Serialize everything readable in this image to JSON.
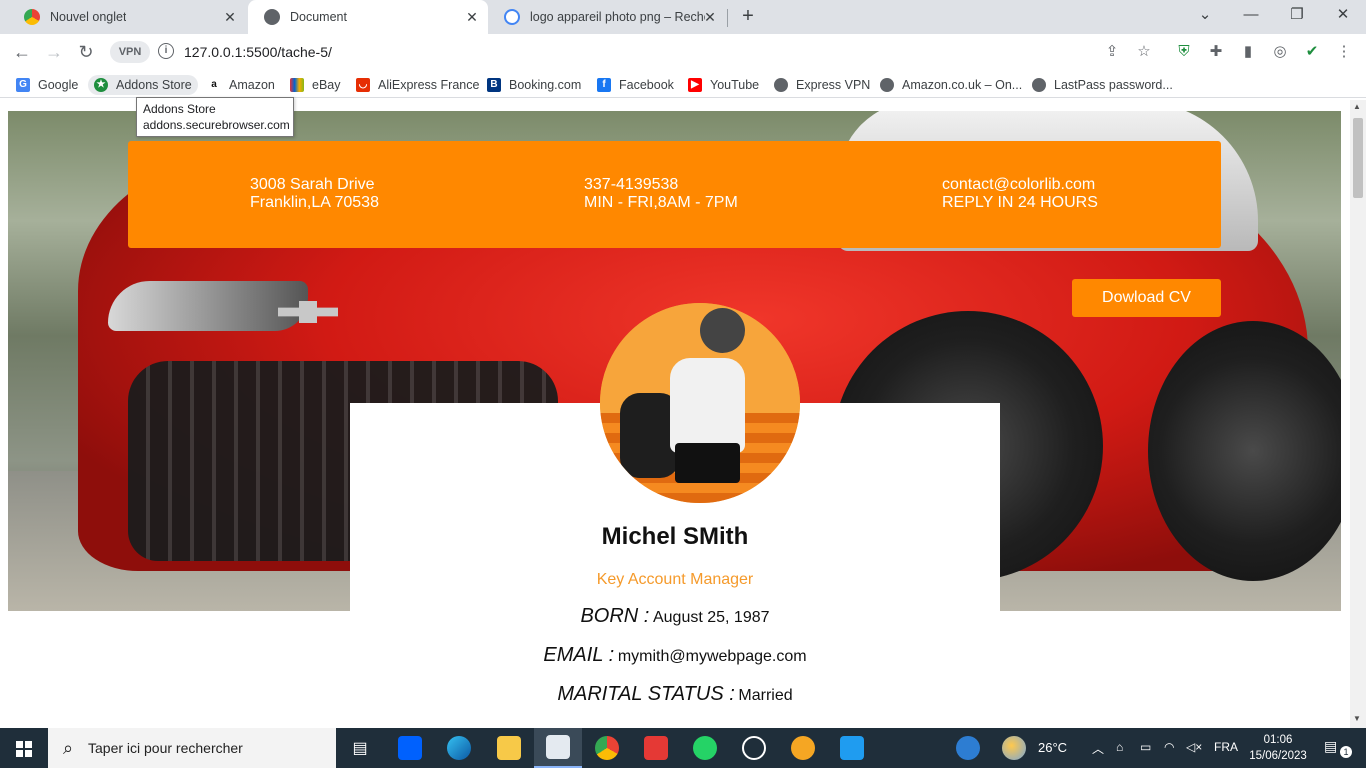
{
  "browser": {
    "tabs": [
      {
        "label": "Nouvel onglet",
        "active": false
      },
      {
        "label": "Document",
        "active": true
      },
      {
        "label": "logo appareil photo png – Reche",
        "active": false
      }
    ],
    "vpn_label": "VPN",
    "url": "127.0.0.1:5500/tache-5/",
    "bookmarks": [
      "Google",
      "Addons Store",
      "Amazon",
      "eBay",
      "AliExpress France",
      "Booking.com",
      "Facebook",
      "YouTube",
      "Express VPN",
      "Amazon.co.uk – On...",
      "LastPass password..."
    ],
    "tooltip": {
      "title": "Addons Store",
      "url": "addons.securebrowser.com"
    }
  },
  "page": {
    "contact": {
      "address_line1": "3008 Sarah Drive",
      "address_line2": "Franklin,LA 70538",
      "phone_line1": "337-4139538",
      "phone_line2": "MIN - FRI,8AM - 7PM",
      "email_line1": "contact@colorlib.com",
      "email_line2": "REPLY IN 24 HOURS"
    },
    "download_label": "Dowload CV",
    "profile": {
      "name": "Michel SMith",
      "role": "Key Account Manager",
      "born_label": "BORN :",
      "born_value": "August 25, 1987",
      "email_label": "EMAIL :",
      "email_value": "mymith@mywebpage.com",
      "marital_label": "MARITAL STATUS :",
      "marital_value": "Married"
    },
    "accent_color": "#ff8800"
  },
  "taskbar": {
    "search_placeholder": "Taper ici pour rechercher",
    "weather": "26°C",
    "language": "FRA",
    "time": "01:06",
    "date": "15/06/2023",
    "notifications": "1"
  }
}
